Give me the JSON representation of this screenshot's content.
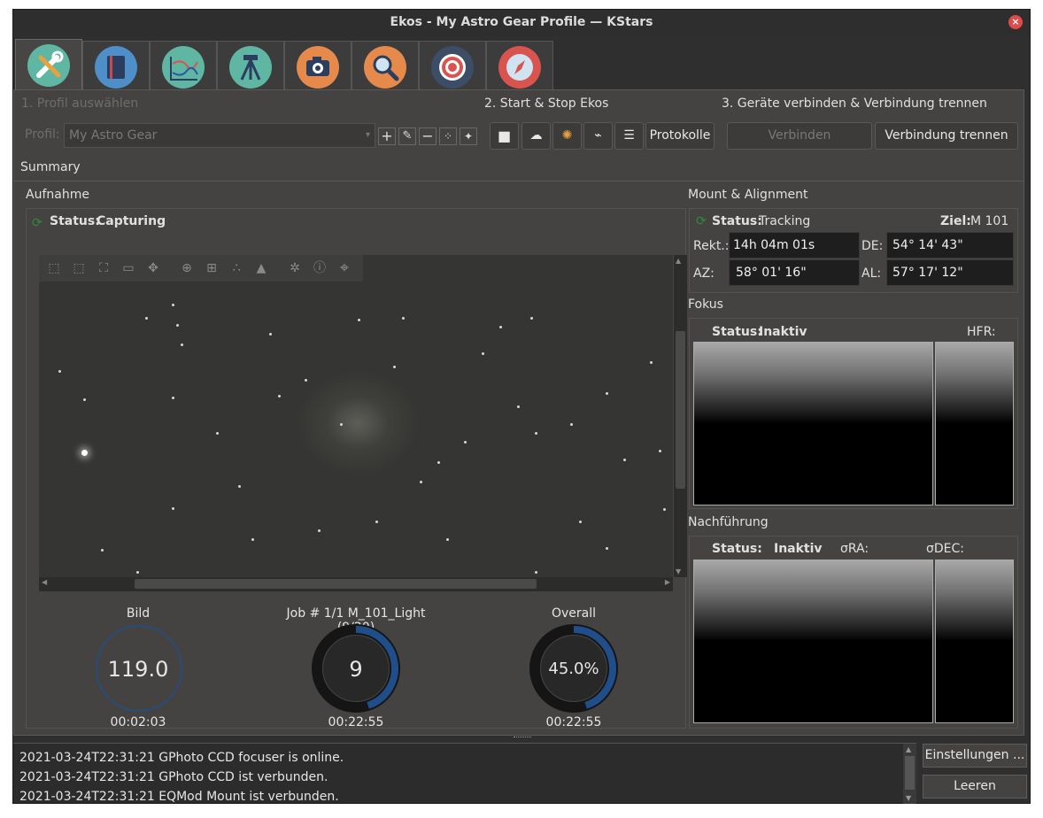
{
  "window": {
    "title": "Ekos - My Astro Gear Profile — KStars",
    "close_glyph": "×"
  },
  "tabs": [
    {
      "name": "setup-icon",
      "color": "#5fb7a3"
    },
    {
      "name": "scheduler-icon",
      "color": "#4f8fc9"
    },
    {
      "name": "analyze-icon",
      "color": "#5fb7a3"
    },
    {
      "name": "mount-icon",
      "color": "#5fb7a3"
    },
    {
      "name": "capture-icon",
      "color": "#e58a4a"
    },
    {
      "name": "focus-icon",
      "color": "#e58a4a"
    },
    {
      "name": "align-icon",
      "color": "#3d4d66"
    },
    {
      "name": "guide-icon",
      "color": "#d9534f"
    }
  ],
  "step1": {
    "label": "1. Profil auswählen",
    "profile_label": "Profil:",
    "profile_value": "My Astro Gear",
    "add_glyph": "+",
    "edit_glyph": "✎",
    "remove_glyph": "−",
    "wizard_glyph": "⁘",
    "magic_glyph": "✦"
  },
  "step2": {
    "label": "2. Start & Stop Ekos",
    "stop_glyph": "■",
    "cloud_glyph": "☁",
    "flash_glyph": "✺",
    "usb_glyph": "⌁",
    "sliders_glyph": "☰",
    "logs_label": "Protokolle"
  },
  "step3": {
    "label": "3. Geräte verbinden & Verbindung trennen",
    "connect_label": "Verbinden",
    "disconnect_label": "Verbindung trennen"
  },
  "summary_label": "Summary",
  "capture": {
    "title": "Aufnahme",
    "status_label": "Status:",
    "status_value": "Capturing",
    "bild_label": "Bild",
    "bild_value": "119.0",
    "bild_time": "00:02:03",
    "job_label": "Job # 1/1 M_101_Light (9/20)",
    "job_value": "9",
    "job_progress": 0.45,
    "job_time": "00:22:55",
    "overall_label": "Overall",
    "overall_value": "45.0%",
    "overall_progress": 0.45,
    "overall_time": "00:22:55",
    "accent": "#1f4e8a"
  },
  "mount": {
    "title": "Mount & Alignment",
    "status_label": "Status:",
    "status_value": "Tracking",
    "target_label": "Ziel:",
    "target_value": "M 101",
    "ra_label": "Rekt.:",
    "ra_value": "14h 04m 01s",
    "de_label": "DE:",
    "de_value": "54° 14' 43\"",
    "az_label": "AZ:",
    "az_value": "58° 01' 16\"",
    "al_label": "AL:",
    "al_value": "57° 17' 12\""
  },
  "focus": {
    "title": "Fokus",
    "status_label": "Status:",
    "status_value": "Inaktiv",
    "hfr_label": "HFR:"
  },
  "guide": {
    "title": "Nachführung",
    "status_label": "Status:",
    "status_value": "Inaktiv",
    "ra_label": "σRA:",
    "dec_label": "σDEC:"
  },
  "log": {
    "lines": [
      "2021-03-24T22:31:21 GPhoto CCD focuser is online.",
      "2021-03-24T22:31:21 GPhoto CCD ist verbunden.",
      "2021-03-24T22:31:21 EQMod Mount ist verbunden."
    ],
    "settings_label": "Einstellungen ...",
    "clear_label": "Leeren"
  }
}
